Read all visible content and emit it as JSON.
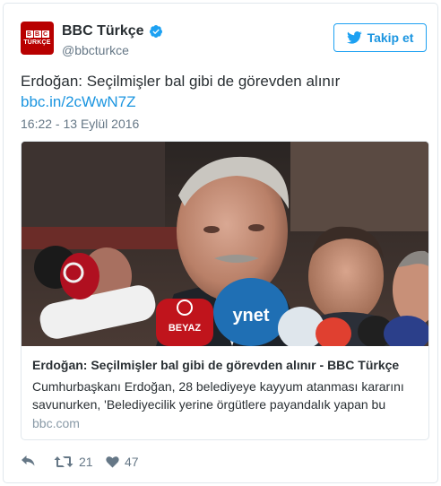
{
  "author": {
    "name": "BBC Türkçe",
    "handle": "@bbcturkce",
    "avatar_letters": [
      "B",
      "B",
      "C"
    ],
    "avatar_sub": "TÜRKÇE",
    "verified_icon": "verified-badge-icon",
    "brand_color": "#b80000"
  },
  "follow_button": {
    "label": "Takip et",
    "icon": "twitter-bird-icon"
  },
  "tweet": {
    "text": "Erdoğan: Seçilmişler bal gibi de görevden alınır",
    "link": "bbc.in/2cWwN7Z",
    "timestamp": "16:22 - 13 Eylül 2016"
  },
  "card": {
    "photo": "news-photo",
    "mic_labels": [
      "BEYAZ",
      "ynet"
    ],
    "title": "Erdoğan: Seçilmişler bal gibi de görevden alınır - BBC Türkçe",
    "description_line1": "Cumhurbaşkanı Erdoğan, 28 belediyeye kayyum atanması kararını",
    "description_line2": "savunurken, 'Belediyecilik yerine örgütlere payandalık yapan bu",
    "domain": "bbc.com"
  },
  "actions": {
    "reply_icon": "reply-icon",
    "retweet_icon": "retweet-icon",
    "retweet_count": "21",
    "like_icon": "heart-icon",
    "like_count": "47"
  },
  "colors": {
    "link": "#1b95e0",
    "muted": "#657786",
    "border": "#e1e8ed"
  }
}
